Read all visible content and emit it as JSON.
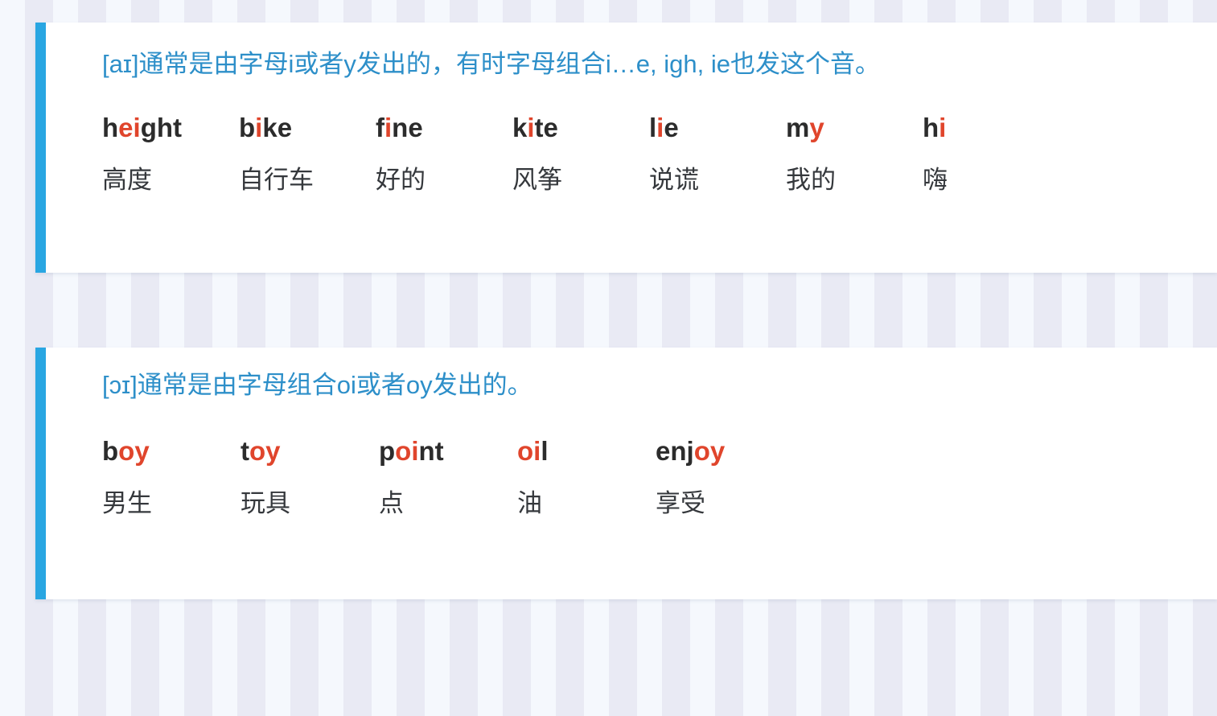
{
  "theme": {
    "accent_bar_color": "#29a6e2",
    "heading_color": "#2d8fc9",
    "highlight_color": "#e0452c",
    "word_color": "#2c2c2c",
    "gloss_color": "#35383c",
    "card_background": "#ffffff",
    "page_stripe_light": "#f5f8fd",
    "page_stripe_dark": "#e9eaf4"
  },
  "cards": [
    {
      "id": "card-ai",
      "phoneme": "[aɪ]",
      "heading": "[aɪ]通常是由字母i或者y发出的，有时字母组合i…e, igh, ie也发这个音。",
      "heading_parts": {
        "full": "[aɪ]通常是由字母i或者y发出的，有时字母组合i…e, igh, ie也发这个音。"
      },
      "entries": [
        {
          "word": "height",
          "pre": "h",
          "hl": "ei",
          "post": "ght",
          "gloss": "高度"
        },
        {
          "word": "bike",
          "pre": "b",
          "hl": "i",
          "post": "ke",
          "gloss": "自行车"
        },
        {
          "word": "fine",
          "pre": "f",
          "hl": "i",
          "post": "ne",
          "gloss": "好的"
        },
        {
          "word": "kite",
          "pre": "k",
          "hl": "i",
          "post": "te",
          "gloss": "风筝"
        },
        {
          "word": "lie",
          "pre": "l",
          "hl": "i",
          "post": "e",
          "gloss": "说谎"
        },
        {
          "word": "my",
          "pre": "m",
          "hl": "y",
          "post": "",
          "gloss": "我的"
        },
        {
          "word": "hi",
          "pre": "h",
          "hl": "i",
          "post": "",
          "gloss": "嗨"
        }
      ]
    },
    {
      "id": "card-oi",
      "phoneme": "[ɔɪ]",
      "heading": "[ɔɪ]通常是由字母组合oi或者oy发出的。",
      "heading_parts": {
        "full": "[ɔɪ]通常是由字母组合oi或者oy发出的。"
      },
      "entries": [
        {
          "word": "boy",
          "pre": "b",
          "hl": "oy",
          "post": "",
          "gloss": "男生"
        },
        {
          "word": "toy",
          "pre": "t",
          "hl": "oy",
          "post": "",
          "gloss": "玩具"
        },
        {
          "word": "point",
          "pre": "p",
          "hl": "oi",
          "post": "nt",
          "gloss": "点"
        },
        {
          "word": "oil",
          "pre": "",
          "hl": "oi",
          "post": "l",
          "gloss": "油"
        },
        {
          "word": "enjoy",
          "pre": "enj",
          "hl": "oy",
          "post": "",
          "gloss": "享受"
        }
      ]
    }
  ]
}
